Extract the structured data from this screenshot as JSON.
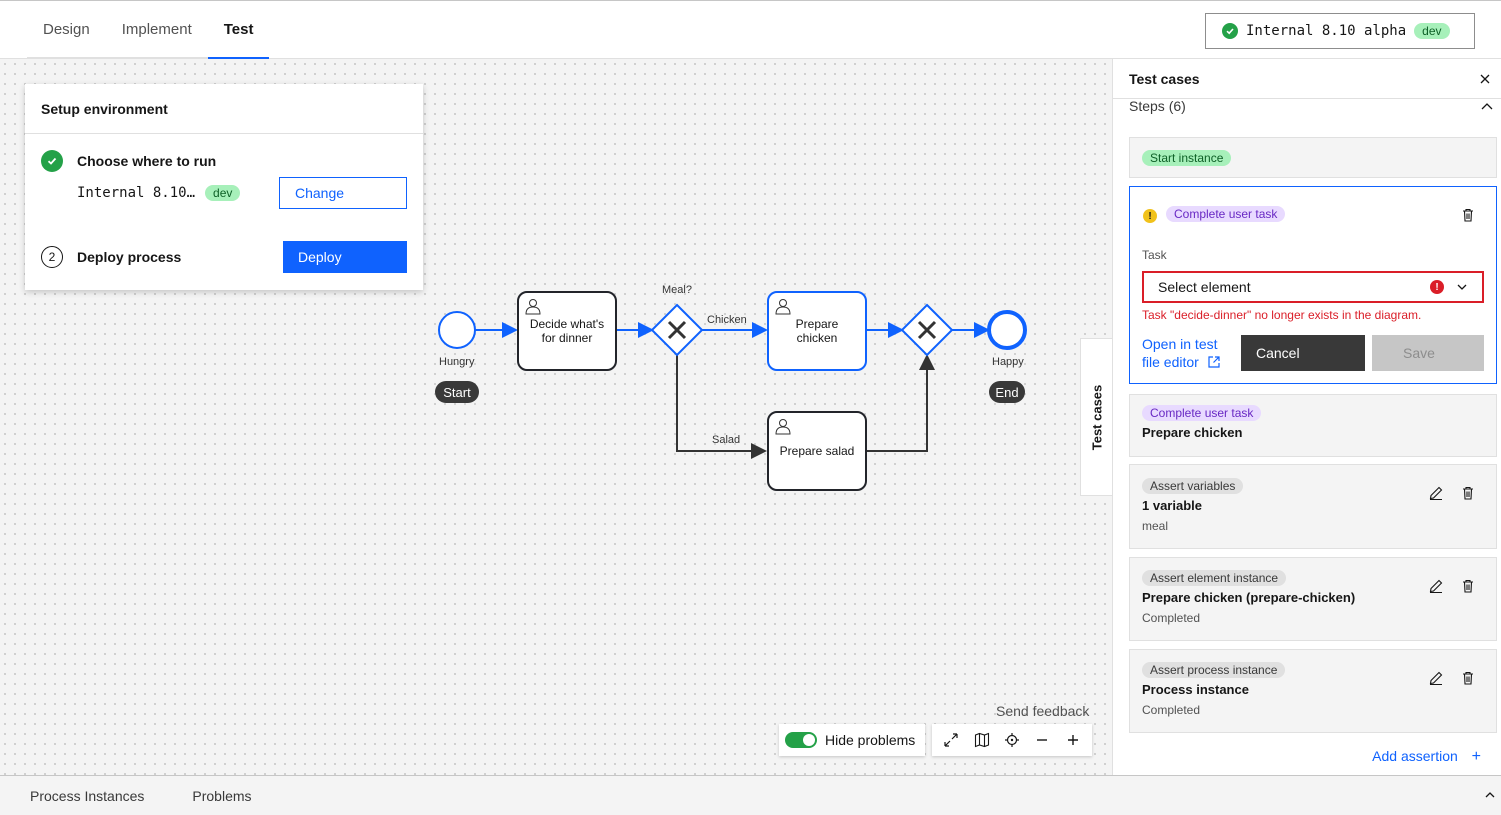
{
  "tabs": [
    "Design",
    "Implement",
    "Test"
  ],
  "active_tab": "Test",
  "cluster": {
    "name": "Internal 8.10 alpha",
    "badge": "dev"
  },
  "setup": {
    "title": "Setup environment",
    "step1_label": "Choose where to run",
    "env_name": "Internal 8.10…",
    "env_badge": "dev",
    "change_label": "Change",
    "step2_number": "2",
    "step2_label": "Deploy process",
    "deploy_label": "Deploy"
  },
  "diagram": {
    "start_label": "Hungry",
    "start_pill": "Start",
    "task1": "Decide what's for dinner",
    "gateway_label": "Meal?",
    "flow_chicken": "Chicken",
    "flow_salad": "Salad",
    "task2": "Prepare chicken",
    "task3": "Prepare salad",
    "end_label": "Happy",
    "end_pill": "End"
  },
  "side_tab_label": "Test cases",
  "feedback": "Send feedback",
  "hide_problems": "Hide problems",
  "panel": {
    "title": "Test cases",
    "steps_header": "Steps (6)",
    "card_start": {
      "tag": "Start instance"
    },
    "edit_card": {
      "tag": "Complete user task",
      "task_label": "Task",
      "select_value": "Select element",
      "error": "Task \"decide-dinner\" no longer exists in the diagram.",
      "open_link": "Open in test file editor",
      "cancel": "Cancel",
      "save": "Save"
    },
    "card_task": {
      "tag": "Complete user task",
      "title": "Prepare chicken"
    },
    "card_vars": {
      "tag": "Assert variables",
      "title": "1 variable",
      "sub": "meal"
    },
    "card_elem": {
      "tag": "Assert element instance",
      "title": "Prepare chicken (prepare-chicken)",
      "sub": "Completed"
    },
    "card_proc": {
      "tag": "Assert process instance",
      "title": "Process instance",
      "sub": "Completed"
    },
    "add_assertion": "Add assertion"
  },
  "bottom": {
    "tab1": "Process Instances",
    "tab2": "Problems"
  },
  "colors": {
    "accent": "#0f62fe",
    "success": "#24a148",
    "error": "#da1e28",
    "warning": "#f1c21b"
  }
}
